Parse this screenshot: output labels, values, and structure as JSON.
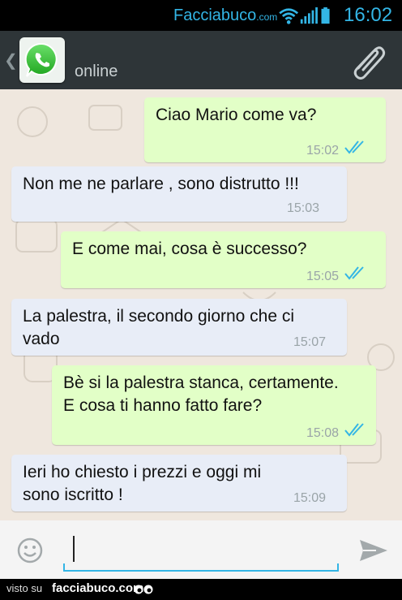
{
  "status_bar": {
    "brand": "Facciabuco",
    "brand_suffix": ".com",
    "time": "16:02",
    "icons": [
      "wifi-icon",
      "signal-icon",
      "battery-icon"
    ],
    "accent_color": "#33b5e5"
  },
  "action_bar": {
    "back_icon": "chevron-left-icon",
    "avatar_icon": "whatsapp-logo-icon",
    "contact_status": "online",
    "attach_icon": "paperclip-icon"
  },
  "messages": [
    {
      "direction": "out",
      "text": "Ciao Mario come va?",
      "time": "15:02",
      "read": true
    },
    {
      "direction": "in",
      "text": "Non me ne parlare , sono distrutto !!!",
      "time": "15:03"
    },
    {
      "direction": "out",
      "text": "E come mai, cosa è successo?",
      "time": "15:05",
      "read": true
    },
    {
      "direction": "in",
      "text": "La palestra, il secondo giorno che ci\nvado",
      "time": "15:07"
    },
    {
      "direction": "out",
      "text": "Bè si la palestra stanca, certamente.\nE cosa ti hanno fatto fare?",
      "time": "15:08",
      "read": true
    },
    {
      "direction": "in",
      "text": "Ieri ho chiesto i prezzi e oggi mi\nsono iscritto !",
      "time": "15:09"
    }
  ],
  "composer": {
    "emoji_icon": "smiley-icon",
    "value": "",
    "send_icon": "send-icon"
  },
  "footer": {
    "seen_on": "visto su",
    "brand": "facciabuco.com"
  }
}
